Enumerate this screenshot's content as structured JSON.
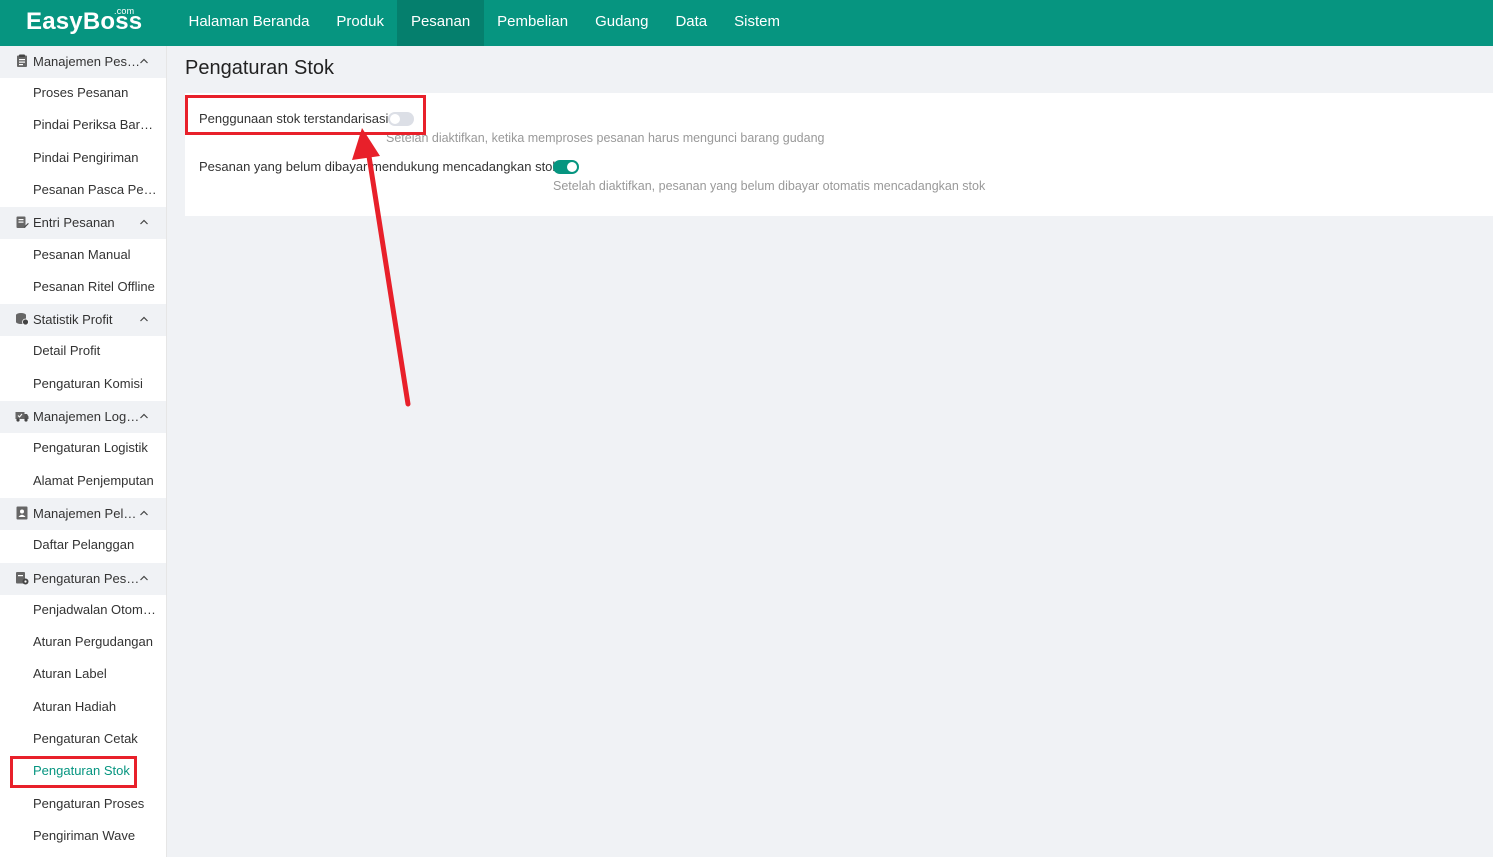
{
  "app": {
    "logo": "EasyBoss",
    "logo_suffix": ".com"
  },
  "topnav": {
    "items": [
      {
        "label": "Halaman Beranda"
      },
      {
        "label": "Produk"
      },
      {
        "label": "Pesanan"
      },
      {
        "label": "Pembelian"
      },
      {
        "label": "Gudang"
      },
      {
        "label": "Data"
      },
      {
        "label": "Sistem"
      }
    ],
    "active": "Pesanan"
  },
  "sidebar": {
    "groups": [
      {
        "label": "Manajemen Pesanan",
        "icon": "clipboard-icon",
        "items": [
          "Proses Pesanan",
          "Pindai Periksa Barang",
          "Pindai Pengiriman",
          "Pesanan Pasca Penjualan"
        ]
      },
      {
        "label": "Entri Pesanan",
        "icon": "document-edit-icon",
        "items": [
          "Pesanan Manual",
          "Pesanan Ritel Offline"
        ]
      },
      {
        "label": "Statistik Profit",
        "icon": "coins-icon",
        "items": [
          "Detail Profit",
          "Pengaturan Komisi"
        ]
      },
      {
        "label": "Manajemen Logistik",
        "icon": "truck-icon",
        "items": [
          "Pengaturan Logistik",
          "Alamat Penjemputan"
        ]
      },
      {
        "label": "Manajemen Pelanggan",
        "icon": "contact-book-icon",
        "items": [
          "Daftar Pelanggan"
        ]
      },
      {
        "label": "Pengaturan Pesanan",
        "icon": "settings-doc-icon",
        "items": [
          "Penjadwalan Otomatis",
          "Aturan Pergudangan",
          "Aturan Label",
          "Aturan Hadiah",
          "Pengaturan Cetak",
          "Pengaturan Stok",
          "Pengaturan Proses",
          "Pengiriman Wave"
        ]
      }
    ],
    "active_item": "Pengaturan Stok"
  },
  "page": {
    "title": "Pengaturan Stok",
    "settings": [
      {
        "label": "Penggunaan stok terstandarisasi:",
        "enabled": false,
        "hint": "Setelah diaktifkan, ketika memproses pesanan harus mengunci barang gudang"
      },
      {
        "label": "Pesanan yang belum dibayar mendukung mencadangkan stok",
        "enabled": true,
        "hint": "Setelah diaktifkan, pesanan yang belum dibayar otomatis mencadangkan stok"
      }
    ]
  },
  "annotations": {
    "highlight_color": "#e8202a"
  },
  "colors": {
    "brand": "#069580",
    "brand_dark": "#057f6d"
  }
}
